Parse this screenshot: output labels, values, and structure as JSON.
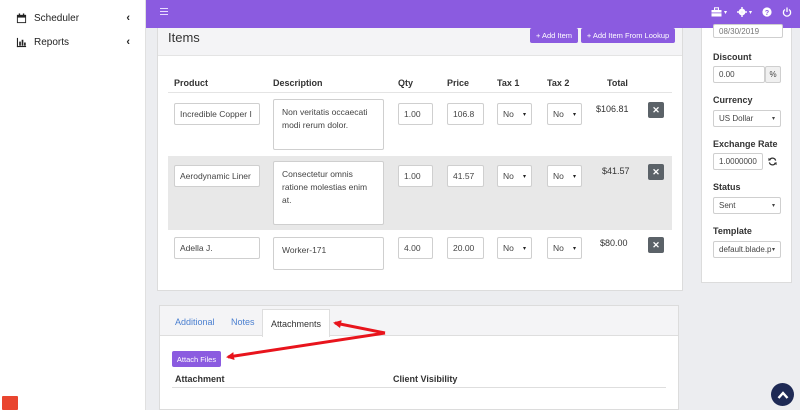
{
  "sidebar": {
    "items": [
      {
        "label": "Scheduler",
        "icon": "calendar-icon"
      },
      {
        "label": "Reports",
        "icon": "bar-chart-icon"
      }
    ]
  },
  "topbar": {
    "icons": [
      "menu-icon",
      "toolbox-icon",
      "settings-icon",
      "help-icon",
      "power-icon"
    ]
  },
  "items": {
    "title": "Items",
    "add_item_label": "+ Add Item",
    "add_lookup_label": "+ Add Item From Lookup",
    "columns": [
      "Product",
      "Description",
      "Qty",
      "Price",
      "Tax 1",
      "Tax 2",
      "Total"
    ],
    "rows": [
      {
        "product": "Incredible Copper I",
        "description": "Non veritatis occaecati modi rerum dolor.",
        "qty": "1.00",
        "price": "106.8",
        "tax1": "No",
        "tax2": "No",
        "total": "$106.81"
      },
      {
        "product": "Aerodynamic Liner",
        "description": "Consectetur omnis ratione molestias enim at.",
        "qty": "1.00",
        "price": "41.57",
        "tax1": "No",
        "tax2": "No",
        "total": "$41.57"
      },
      {
        "product": "Adella J.",
        "description": "Worker-171",
        "qty": "4.00",
        "price": "20.00",
        "tax1": "No",
        "tax2": "No",
        "total": "$80.00"
      }
    ],
    "delete_label": "✕"
  },
  "right_panel": {
    "date_value": "08/30/2019",
    "discount_label": "Discount",
    "discount_value": "0.00",
    "discount_unit": "%",
    "currency_label": "Currency",
    "currency_value": "US Dollar",
    "exchange_label": "Exchange Rate",
    "exchange_value": "1.0000000",
    "status_label": "Status",
    "status_value": "Sent",
    "template_label": "Template",
    "template_value": "default.blade.p"
  },
  "tabs": {
    "items": [
      "Additional",
      "Notes",
      "Attachments"
    ],
    "active": "Attachments",
    "attach_button": "Attach Files",
    "columns": [
      "Attachment",
      "Client Visibility"
    ]
  },
  "colors": {
    "accent": "#8b5be0",
    "arrow": "#e8141c",
    "scroll_top": "#1e2a55"
  }
}
